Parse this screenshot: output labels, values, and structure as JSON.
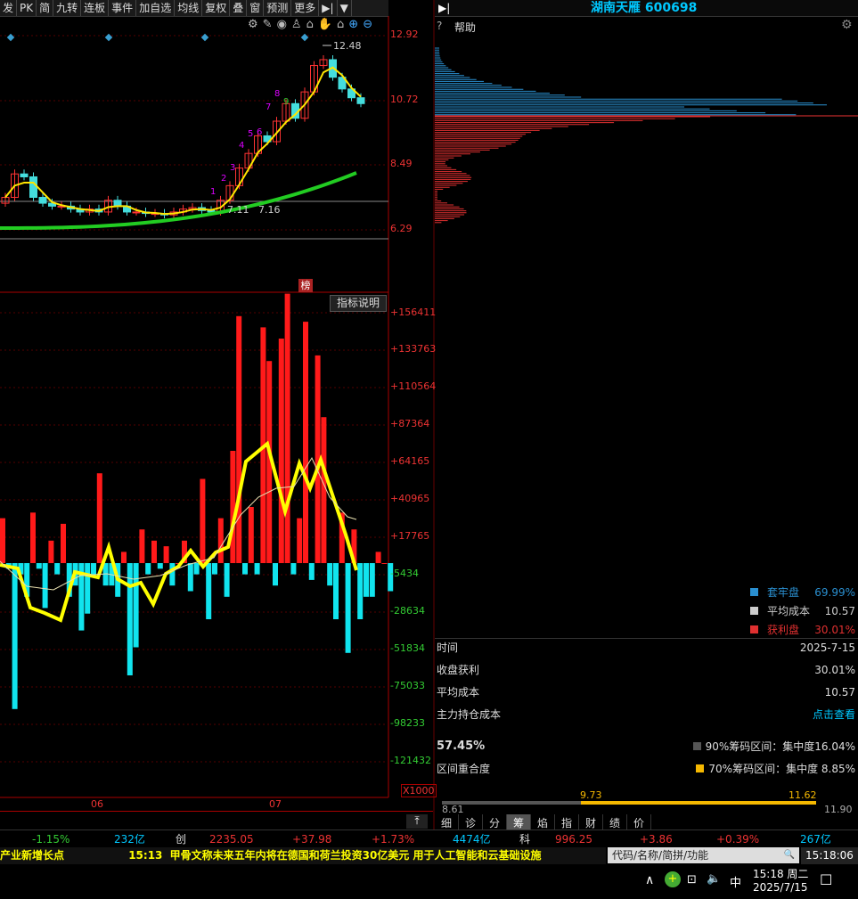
{
  "toolbar": {
    "items": [
      "发",
      "PK",
      "简",
      "九转",
      "连板",
      "事件",
      "加自选",
      "均线",
      "复权",
      "叠",
      "窗",
      "预测",
      "更多"
    ]
  },
  "stock": {
    "title": "湖南天雁 600698"
  },
  "help": {
    "label": "帮助"
  },
  "price_chart": {
    "axis": [
      "12.92",
      "10.72",
      "8.49",
      "6.29"
    ],
    "high_label": "12.48",
    "low_label": "7.11",
    "low_label2": "7.16",
    "ma_marker": "榜",
    "nine_turn": [
      "1",
      "2",
      "3",
      "4",
      "5",
      "6",
      "7",
      "8",
      "9"
    ]
  },
  "volume_chart": {
    "indicator_button": "指标说明",
    "axis": [
      "+156411",
      "+133763",
      "+110564",
      "+87364",
      "+64165",
      "+40965",
      "+17765",
      "-5434",
      "-28634",
      "-51834",
      "-75033",
      "-98233",
      "-121432"
    ],
    "unit": "X1000",
    "months": [
      "06",
      "07"
    ]
  },
  "chip": {
    "legend": [
      {
        "label": "套牢盘",
        "value": "69.99%",
        "color": "#2a8fd0"
      },
      {
        "label": "平均成本",
        "value": "10.57",
        "color": "#cccccc"
      },
      {
        "label": "获利盘",
        "value": "30.01%",
        "color": "#e03030"
      }
    ],
    "rows": [
      {
        "label": "时间",
        "value": "2025-7-15"
      },
      {
        "label": "收盘获利",
        "value": "30.01%"
      },
      {
        "label": "平均成本",
        "value": "10.57"
      },
      {
        "label": "主力持仓成本",
        "value": "点击查看"
      }
    ],
    "overlap_pct": "57.45%",
    "overlap_label": "区间重合度",
    "range90": "90%筹码区间：集中度16.04%",
    "range70": "70%筹码区间：集中度 8.85%",
    "range_vals": {
      "low": "8.61",
      "mid": "9.73",
      "high": "11.62",
      "top": "11.90"
    }
  },
  "tabs": [
    "细",
    "诊",
    "分",
    "筹",
    "焰",
    "指",
    "财",
    "绩",
    "价"
  ],
  "status": {
    "p1": "-1.15%",
    "v1": "232亿",
    "idx2": "创",
    "v2": "2235.05",
    "c2": "+37.98",
    "p2": "+1.73%",
    "a2": "4474亿",
    "idx3": "科",
    "v3": "996.25",
    "c3": "+3.86",
    "p3": "+0.39%",
    "a3": "267亿"
  },
  "ticker": {
    "left": "产业新增长点",
    "time": "15:13",
    "text": "甲骨文称未来五年内将在德国和荷兰投资30亿美元 用于人工智能和云基础设施"
  },
  "search": {
    "placeholder": "代码/名称/简拼/功能"
  },
  "clock": "15:18:06",
  "taskbar": {
    "time": "15:18 周二",
    "date": "2025/7/15",
    "ime": "中"
  },
  "chart_data": {
    "type": "bar",
    "title": "",
    "ylim": [
      -145000,
      165000
    ]
  }
}
